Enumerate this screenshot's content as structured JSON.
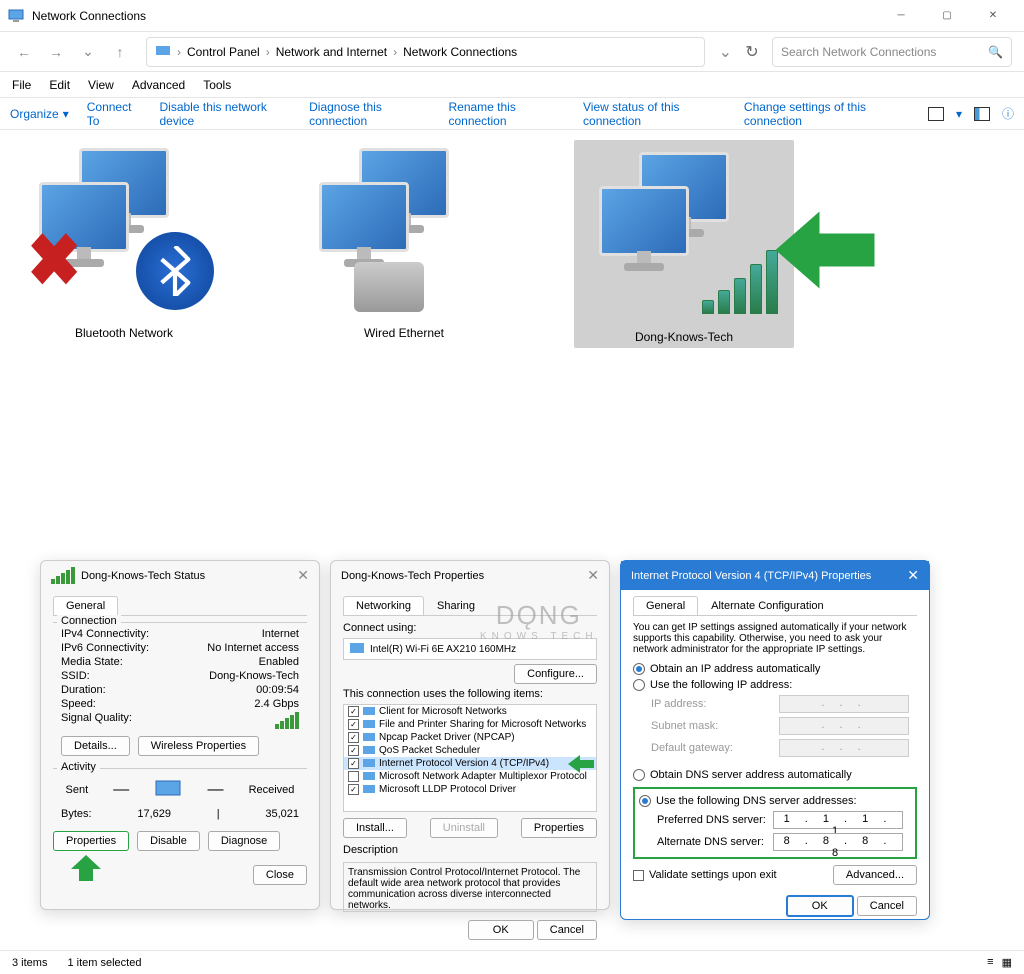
{
  "window": {
    "title": "Network Connections"
  },
  "breadcrumb": {
    "p1": "Control Panel",
    "p2": "Network and Internet",
    "p3": "Network Connections"
  },
  "search": {
    "placeholder": "Search Network Connections"
  },
  "menu": {
    "file": "File",
    "edit": "Edit",
    "view": "View",
    "advanced": "Advanced",
    "tools": "Tools"
  },
  "toolbar": {
    "organize": "Organize",
    "connect_to": "Connect To",
    "disable": "Disable this network device",
    "diagnose": "Diagnose this connection",
    "rename": "Rename this connection",
    "view_status": "View status of this connection",
    "change_settings": "Change settings of this connection"
  },
  "connections": {
    "bluetooth": "Bluetooth Network",
    "wired": "Wired Ethernet",
    "wifi": "Dong-Knows-Tech"
  },
  "status_dialog": {
    "title": "Dong-Knows-Tech Status",
    "tab_general": "General",
    "group_connection": "Connection",
    "ipv4_label": "IPv4 Connectivity:",
    "ipv4_value": "Internet",
    "ipv6_label": "IPv6 Connectivity:",
    "ipv6_value": "No Internet access",
    "media_label": "Media State:",
    "media_value": "Enabled",
    "ssid_label": "SSID:",
    "ssid_value": "Dong-Knows-Tech",
    "duration_label": "Duration:",
    "duration_value": "00:09:54",
    "speed_label": "Speed:",
    "speed_value": "2.4 Gbps",
    "signal_label": "Signal Quality:",
    "details_btn": "Details...",
    "wireless_btn": "Wireless Properties",
    "group_activity": "Activity",
    "sent_label": "Sent",
    "received_label": "Received",
    "bytes_label": "Bytes:",
    "sent_value": "17,629",
    "received_value": "35,021",
    "properties_btn": "Properties",
    "disable_btn": "Disable",
    "diagnose_btn": "Diagnose",
    "close_btn": "Close"
  },
  "props_dialog": {
    "title": "Dong-Knows-Tech Properties",
    "tab_networking": "Networking",
    "tab_sharing": "Sharing",
    "connect_using": "Connect using:",
    "adapter": "Intel(R) Wi-Fi 6E AX210 160MHz",
    "configure_btn": "Configure...",
    "items_label": "This connection uses the following items:",
    "items": [
      {
        "checked": true,
        "label": "Client for Microsoft Networks"
      },
      {
        "checked": true,
        "label": "File and Printer Sharing for Microsoft Networks"
      },
      {
        "checked": true,
        "label": "Npcap Packet Driver (NPCAP)"
      },
      {
        "checked": true,
        "label": "QoS Packet Scheduler"
      },
      {
        "checked": true,
        "label": "Internet Protocol Version 4 (TCP/IPv4)",
        "selected": true
      },
      {
        "checked": false,
        "label": "Microsoft Network Adapter Multiplexor Protocol"
      },
      {
        "checked": true,
        "label": "Microsoft LLDP Protocol Driver"
      }
    ],
    "install_btn": "Install...",
    "uninstall_btn": "Uninstall",
    "properties_btn": "Properties",
    "desc_label": "Description",
    "desc_text": "Transmission Control Protocol/Internet Protocol. The default wide area network protocol that provides communication across diverse interconnected networks.",
    "ok_btn": "OK",
    "cancel_btn": "Cancel"
  },
  "tcpip_dialog": {
    "title": "Internet Protocol Version 4 (TCP/IPv4) Properties",
    "tab_general": "General",
    "tab_alt": "Alternate Configuration",
    "intro": "You can get IP settings assigned automatically if your network supports this capability. Otherwise, you need to ask your network administrator for the appropriate IP settings.",
    "obtain_ip": "Obtain an IP address automatically",
    "use_ip": "Use the following IP address:",
    "ip_address": "IP address:",
    "subnet": "Subnet mask:",
    "gateway": "Default gateway:",
    "obtain_dns": "Obtain DNS server address automatically",
    "use_dns": "Use the following DNS server addresses:",
    "pref_dns": "Preferred DNS server:",
    "pref_dns_value": "1 . 1 . 1 . 1",
    "alt_dns": "Alternate DNS server:",
    "alt_dns_value": "8 . 8 . 8 . 8",
    "validate": "Validate settings upon exit",
    "advanced_btn": "Advanced...",
    "ok_btn": "OK",
    "cancel_btn": "Cancel"
  },
  "statusbar": {
    "items": "3 items",
    "selected": "1 item selected"
  },
  "watermark": {
    "main": "DǪNG",
    "sub": "KNOWS TECH"
  }
}
